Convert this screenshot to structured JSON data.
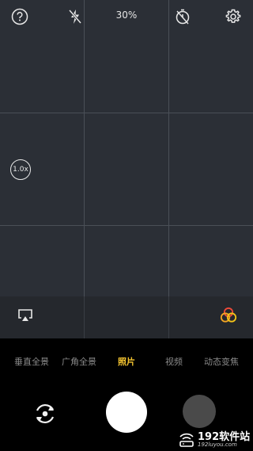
{
  "status": {
    "battery_text": "30%"
  },
  "zoom": {
    "label": "1.0x"
  },
  "modes": [
    {
      "label": "垂直全景",
      "active": false
    },
    {
      "label": "广角全景",
      "active": false
    },
    {
      "label": "照片",
      "active": true
    },
    {
      "label": "视频",
      "active": false
    },
    {
      "label": "动态变焦",
      "active": false
    }
  ],
  "watermark": {
    "main": "192软件站",
    "sub": "192luyou.com"
  },
  "colors": {
    "accent": "#f4c430",
    "viewfinder": "#2b2f36"
  },
  "icons": {
    "help": "help-icon",
    "flash": "flash-off-icon",
    "timer": "timer-off-icon",
    "settings": "gear-icon",
    "screen_mirror": "screen-mirror-icon",
    "filters": "filters-icon",
    "switch_camera": "switch-camera-icon"
  }
}
